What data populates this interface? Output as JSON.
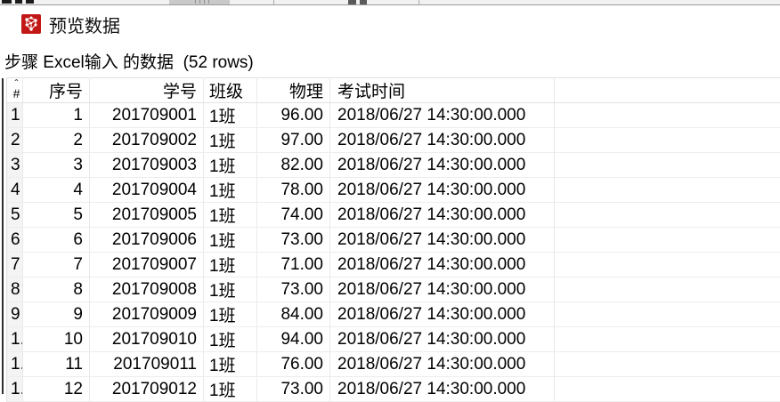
{
  "dialog": {
    "title": "预览数据",
    "subtitle": "步骤 Excel输入 的数据  (52 rows)"
  },
  "table": {
    "sort_indicator": "ˆ",
    "columns": [
      {
        "id": "rownum",
        "label": "#"
      },
      {
        "id": "xuhao",
        "label": "序号"
      },
      {
        "id": "xuehao",
        "label": "学号"
      },
      {
        "id": "banji",
        "label": "班级"
      },
      {
        "id": "wuli",
        "label": "物理"
      },
      {
        "id": "kaoshi_shijian",
        "label": "考试时间"
      }
    ],
    "rows": [
      [
        "1",
        "1",
        "201709001",
        "1班",
        "96.00",
        "2018/06/27 14:30:00.000"
      ],
      [
        "2",
        "2",
        "201709002",
        "1班",
        "97.00",
        "2018/06/27 14:30:00.000"
      ],
      [
        "3",
        "3",
        "201709003",
        "1班",
        "82.00",
        "2018/06/27 14:30:00.000"
      ],
      [
        "4",
        "4",
        "201709004",
        "1班",
        "78.00",
        "2018/06/27 14:30:00.000"
      ],
      [
        "5",
        "5",
        "201709005",
        "1班",
        "74.00",
        "2018/06/27 14:30:00.000"
      ],
      [
        "6",
        "6",
        "201709006",
        "1班",
        "73.00",
        "2018/06/27 14:30:00.000"
      ],
      [
        "7",
        "7",
        "201709007",
        "1班",
        "71.00",
        "2018/06/27 14:30:00.000"
      ],
      [
        "8",
        "8",
        "201709008",
        "1班",
        "73.00",
        "2018/06/27 14:30:00.000"
      ],
      [
        "9",
        "9",
        "201709009",
        "1班",
        "84.00",
        "2018/06/27 14:30:00.000"
      ],
      [
        "1.",
        "10",
        "201709010",
        "1班",
        "94.00",
        "2018/06/27 14:30:00.000"
      ],
      [
        "1.",
        "11",
        "201709011",
        "1班",
        "76.00",
        "2018/06/27 14:30:00.000"
      ],
      [
        "1.",
        "12",
        "201709012",
        "1班",
        "73.00",
        "2018/06/27 14:30:00.000"
      ]
    ],
    "icon_color": "#c21717"
  }
}
